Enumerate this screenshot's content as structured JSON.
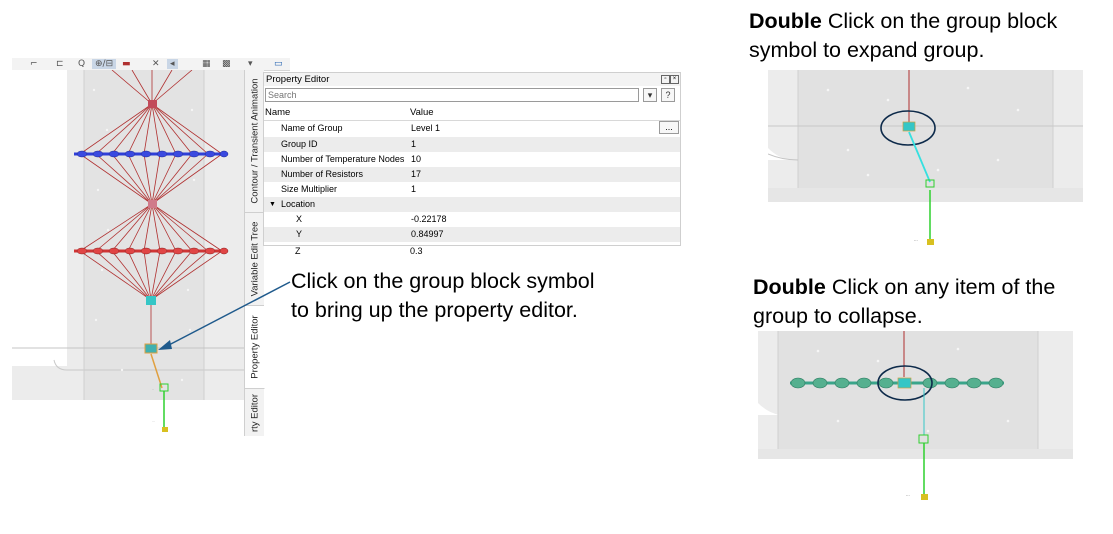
{
  "toolbar": {
    "icons": [
      "pointer-icon",
      "snap-icon",
      "zoom-icon",
      "fit-icon",
      "view-icon",
      "grid-icon",
      "menu-icon"
    ],
    "zoom_label": "⊕/⊟"
  },
  "tabs": [
    {
      "label": "Contour / Transient Animation",
      "active": false
    },
    {
      "label": "Variable Edit Tree",
      "active": false
    },
    {
      "label": "Property Editor",
      "active": true
    },
    {
      "label": "rty Editor",
      "active": false
    }
  ],
  "property_editor": {
    "title": "Property Editor",
    "search_placeholder": "Search",
    "help_label": "?",
    "dropdown_label": "▾",
    "columns": {
      "name": "Name",
      "value": "Value"
    },
    "ellipsis_label": "...",
    "rows": [
      {
        "name": "Name of Group",
        "value": "Level 1"
      },
      {
        "name": "Group ID",
        "value": "1"
      },
      {
        "name": "Number of Temperature Nodes",
        "value": "10"
      },
      {
        "name": "Number of Resistors",
        "value": "17"
      },
      {
        "name": "Size Multiplier",
        "value": "1"
      }
    ],
    "location": {
      "label": "Location",
      "rows": [
        {
          "name": "X",
          "value": "-0.22178"
        },
        {
          "name": "Y",
          "value": "0.84997"
        },
        {
          "name": "Z",
          "value": "0.3"
        }
      ]
    }
  },
  "captions": {
    "property_hint_line1": "Click on the group block symbol",
    "property_hint_line2": "to bring up the property editor.",
    "expand_bold": "Double",
    "expand_line1": " Click on the group block",
    "expand_line2": "symbol to expand group.",
    "collapse_bold": "Double",
    "collapse_line1": " Click on any item of the",
    "collapse_line2": "group to collapse."
  },
  "colors": {
    "accent_blue": "#1f5a8c",
    "red_network": "#b03030",
    "blue_network": "#2f3fd8",
    "cyan_block": "#35c6c6",
    "green_line": "#2ed02e",
    "orange_line": "#e0a040",
    "teal_collapsed": "#3aa58a",
    "circle_outline": "#0d2a4a"
  }
}
